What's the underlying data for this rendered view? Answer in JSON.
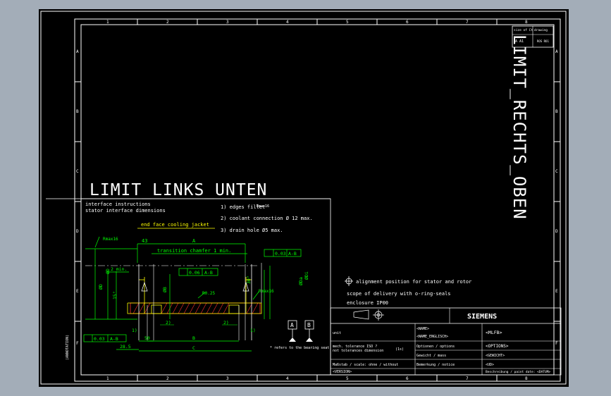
{
  "frame": {
    "columns": [
      "1",
      "2",
      "3",
      "4",
      "5",
      "6",
      "7",
      "8"
    ],
    "rows": [
      "A",
      "B",
      "C",
      "D",
      "E",
      "F"
    ],
    "side_label": "(ANNOTATION)"
  },
  "titles": {
    "limit_links_unten": "LIMIT_LINKS_UNTEN",
    "limit_rechts_oben": "LIMIT_RECHTS_OBEN"
  },
  "corner_block": {
    "top_left": "size of Ct",
    "top_right": "drawing",
    "mid_left": "A  A1",
    "mid_right": "ROS  RO1"
  },
  "interface": {
    "heading1": "interface instructions",
    "heading2": "stator interface dimensions",
    "note1": "1) edges fillet",
    "note1_sub": "Rmax16",
    "note2": "2) coolant connection Ø 12 max.",
    "note3": "3) drain hole Ø5 max.",
    "end_face": "end face cooling jacket",
    "transition": "transition chamfer  1 min.",
    "rmax16": "Rmax16",
    "dim_43": "43",
    "dim_A": "A",
    "dim_2min": "2 min.",
    "dim_15": "15°",
    "dim_30": "30°",
    "dim_phiD": "ØD",
    "dim_phiB": "ØB",
    "dim_phiDi": "ØDi",
    "dim_phiDa": "ØDa",
    "tol_006": "0.06",
    "tol_003": "0.03",
    "ref_AB": "A-B",
    "fil_025": "R0.25",
    "dim_Rmax16b": "Rmax16",
    "dim_285": "28.5",
    "dim_50": "50",
    "dim_B": "B",
    "dim_C": "C",
    "dim_1": "1)",
    "dim_2": "2)",
    "datum_A": "A",
    "datum_B": "B",
    "refer_note": "* refers to the bearing seat"
  },
  "notes_right": {
    "alignment": "alignment position for stator and rotor",
    "scope": "scope of delivery with o-ring-seals",
    "enclosure": "enclosure IP00"
  },
  "title_block": {
    "brand": "SIEMENS",
    "unit_label": "unit",
    "name1": "<NAME>",
    "name2": "<NAME_ENGLISCH>",
    "mlfb": "<MLFB>",
    "general_tol": "mech. tolerance ISO ?",
    "not_tol": "not tolerances dimension",
    "projection_sym": "(1s)",
    "options_label": "Optionen / options",
    "options_val": "<OPTIONS>",
    "weight_label": "Gewicht / mass",
    "weight_val": "<GEWICHT>",
    "scale_label": "Maßstab / scale: ohne / without",
    "remark_label": "Bemerkung / notice",
    "remark_val": "<UD>",
    "version": "<VERSION>",
    "description": "Beschreibung / paint date: <DATUM>"
  }
}
